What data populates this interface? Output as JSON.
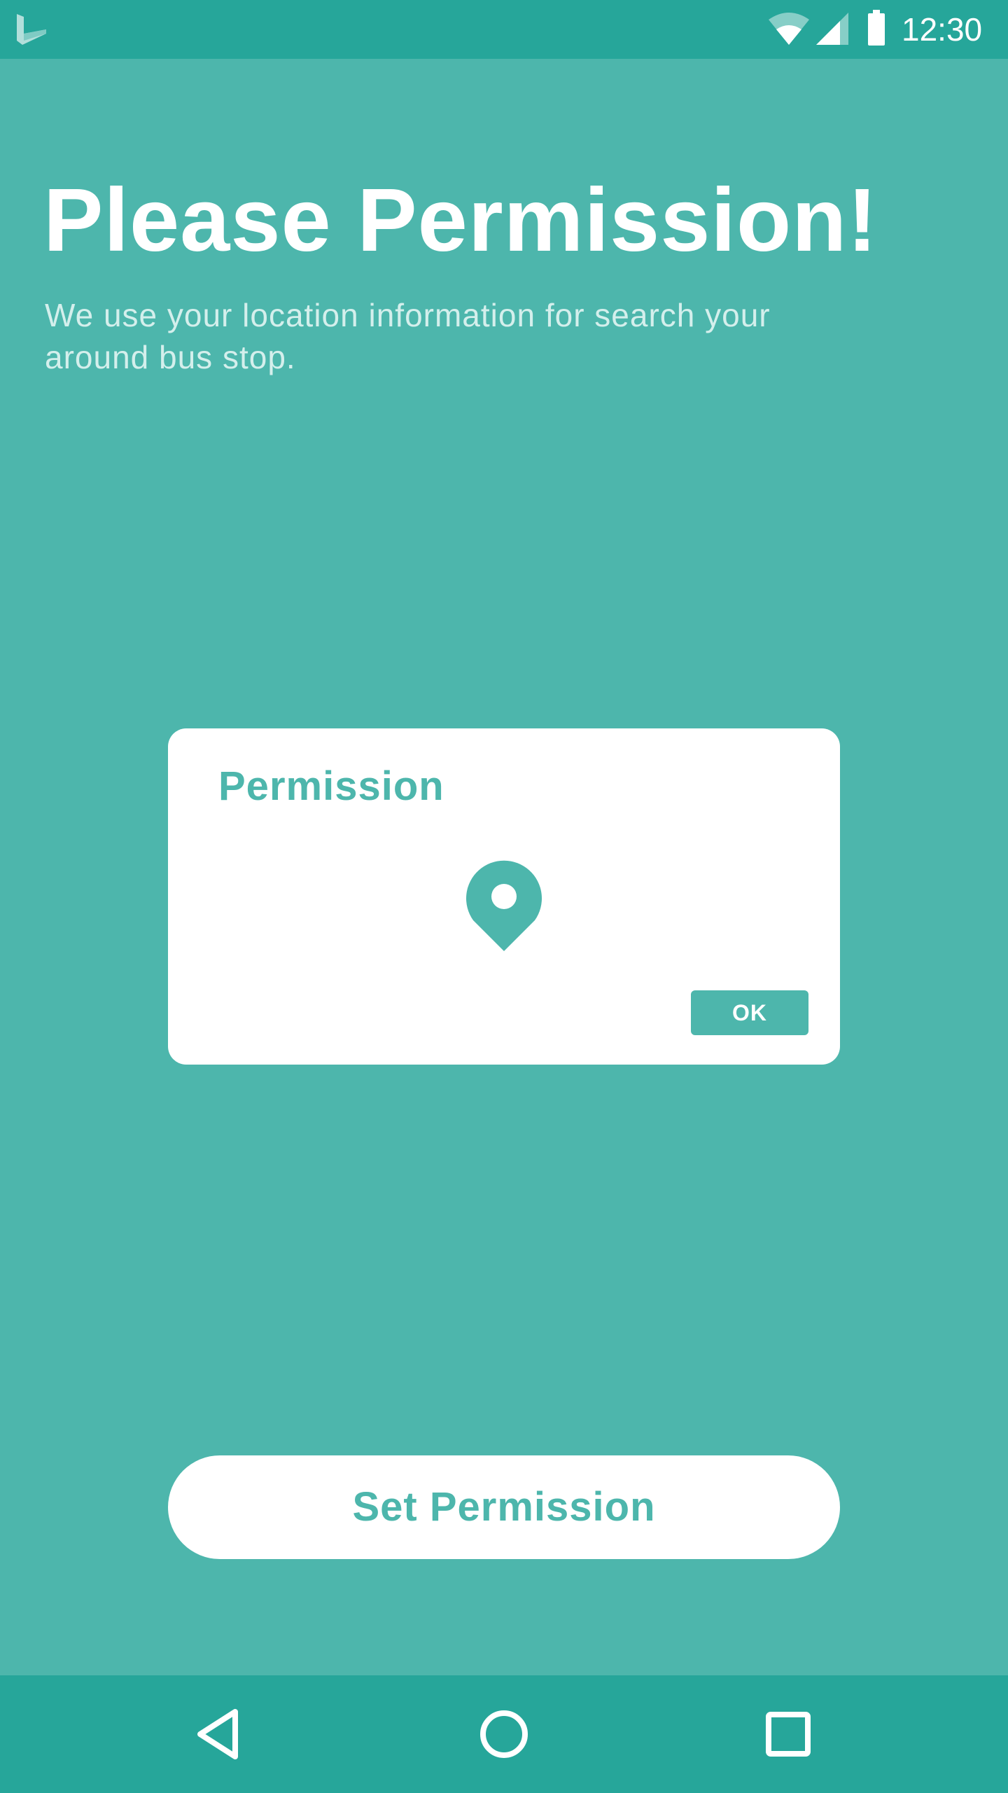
{
  "status_bar": {
    "time": "12:30",
    "icons": [
      "app-logo-icon",
      "wifi-icon",
      "signal-icon",
      "battery-icon"
    ]
  },
  "main": {
    "heading": "Please Permission!",
    "subtitle": "We use your location information for search your around bus stop."
  },
  "dialog": {
    "title": "Permission",
    "icon": "location-pin-icon",
    "ok_label": "OK"
  },
  "actions": {
    "set_permission_label": "Set Permission"
  },
  "nav_bar": {
    "icons": [
      "back-icon",
      "home-icon",
      "recents-icon"
    ]
  },
  "colors": {
    "background": "#4db6ac",
    "bars": "#26a69a",
    "accent": "#4db6ac",
    "surface": "#ffffff"
  }
}
